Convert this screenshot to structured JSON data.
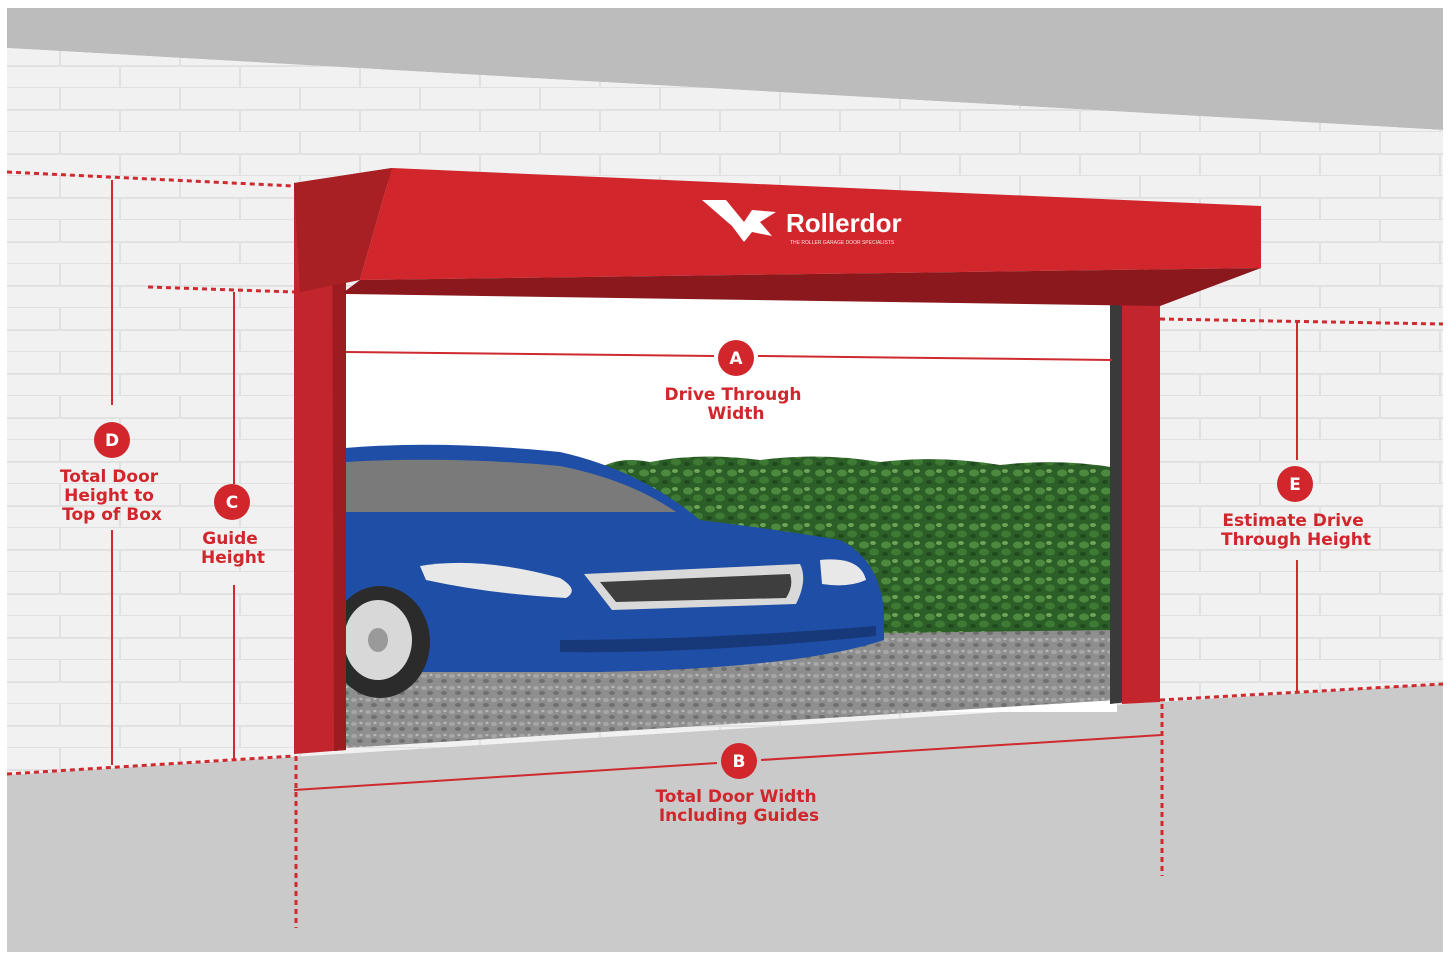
{
  "colors": {
    "brand_red": "#d0262c",
    "dark_red": "#9b1d21",
    "wall": "#f0f0f0",
    "sky": "#ffffff",
    "floor": "#c9c9c9",
    "top_band": "#bdbdbd",
    "car_blue": "#1f4fa6",
    "hedge": "#2f6b2b",
    "gravel": "#8b8b8b"
  },
  "brand": {
    "name": "Rollerdor",
    "tagline": "THE ROLLER GARAGE DOOR SPECIALISTS",
    "logo_icon": "rollerdor-logo-icon"
  },
  "measurements": [
    {
      "letter": "A",
      "lines": [
        "Drive Through",
        "Width"
      ]
    },
    {
      "letter": "B",
      "lines": [
        "Total Door Width",
        "Including Guides"
      ]
    },
    {
      "letter": "C",
      "lines": [
        "Guide",
        "Height"
      ]
    },
    {
      "letter": "D",
      "lines": [
        "Total Door",
        "Height to",
        "Top of Box"
      ]
    },
    {
      "letter": "E",
      "lines": [
        "Estimate Drive",
        "Through Height"
      ]
    }
  ]
}
